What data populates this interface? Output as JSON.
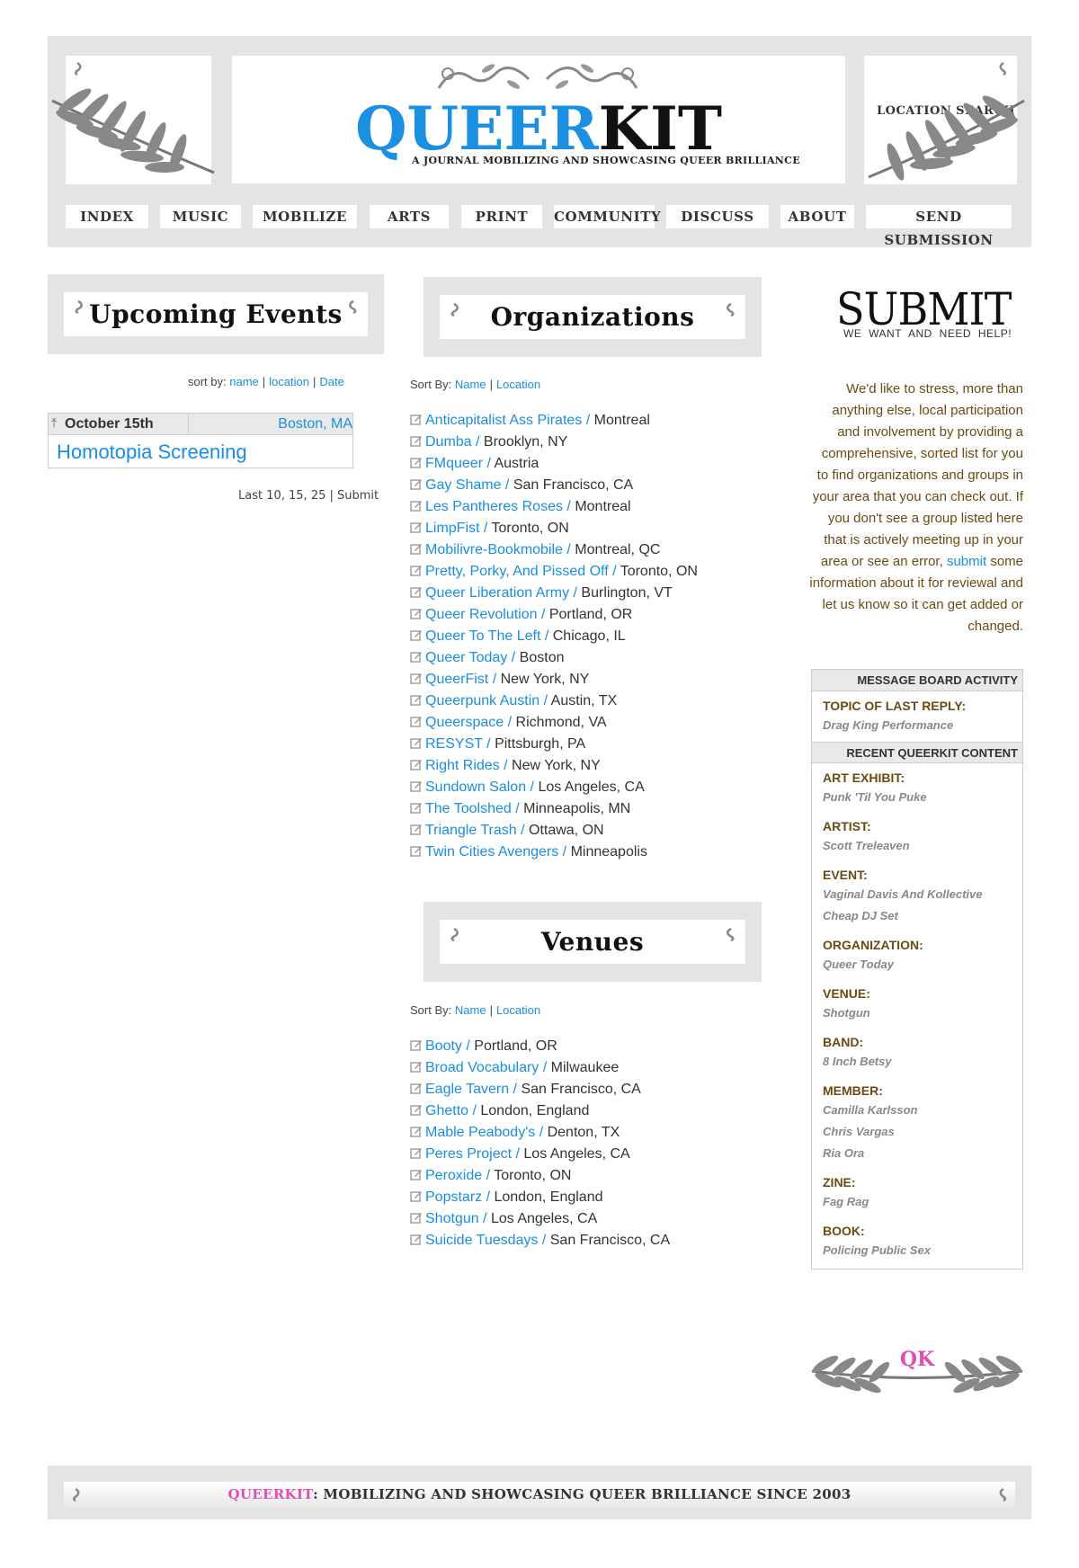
{
  "header": {
    "logo_queer": "QUEER",
    "logo_kit": "KIT",
    "tagline": "A JOURNAL MOBILIZING AND SHOWCASING QUEER BRILLIANCE",
    "location_search": "LOCATION SEARCH",
    "nav": [
      "INDEX",
      "MUSIC",
      "MOBILIZE",
      "ARTS",
      "PRINT",
      "COMMUNITY",
      "DISCUSS",
      "ABOUT",
      "SEND SUBMISSION"
    ]
  },
  "events": {
    "title": "Upcoming Events",
    "sort_prefix": "sort by:",
    "sort_links": [
      "name",
      "location",
      "Date"
    ],
    "items": [
      {
        "date": "October 15th",
        "location": "Boston, MA",
        "title": "Homotopia Screening"
      }
    ],
    "footer": "Last 10, 15, 25 | Submit"
  },
  "organizations": {
    "title": "Organizations",
    "sort_prefix": "Sort By:",
    "sort_links": [
      "Name",
      "Location"
    ],
    "items": [
      {
        "name": "Anticapitalist Ass Pirates /",
        "location": "Montreal"
      },
      {
        "name": "Dumba /",
        "location": "Brooklyn, NY"
      },
      {
        "name": "FMqueer /",
        "location": "Austria"
      },
      {
        "name": "Gay Shame /",
        "location": "San Francisco, CA"
      },
      {
        "name": "Les Pantheres Roses /",
        "location": "Montreal"
      },
      {
        "name": "LimpFist /",
        "location": "Toronto, ON"
      },
      {
        "name": "Mobilivre-Bookmobile /",
        "location": "Montreal, QC"
      },
      {
        "name": "Pretty, Porky, And Pissed Off /",
        "location": "Toronto, ON"
      },
      {
        "name": "Queer Liberation Army /",
        "location": "Burlington, VT"
      },
      {
        "name": "Queer Revolution /",
        "location": "Portland, OR"
      },
      {
        "name": "Queer To The Left /",
        "location": "Chicago, IL"
      },
      {
        "name": "Queer Today /",
        "location": "Boston"
      },
      {
        "name": "QueerFist /",
        "location": "New York, NY"
      },
      {
        "name": "Queerpunk Austin /",
        "location": "Austin, TX"
      },
      {
        "name": "Queerspace /",
        "location": "Richmond, VA"
      },
      {
        "name": "RESYST /",
        "location": "Pittsburgh, PA"
      },
      {
        "name": "Right Rides /",
        "location": "New York, NY"
      },
      {
        "name": "Sundown Salon /",
        "location": "Los Angeles, CA"
      },
      {
        "name": "The Toolshed /",
        "location": "Minneapolis, MN"
      },
      {
        "name": "Triangle Trash /",
        "location": "Ottawa, ON"
      },
      {
        "name": "Twin Cities Avengers /",
        "location": "Minneapolis"
      }
    ]
  },
  "venues": {
    "title": "Venues",
    "sort_prefix": "Sort By:",
    "sort_links": [
      "Name",
      "Location"
    ],
    "items": [
      {
        "name": "Booty /",
        "location": "Portland, OR"
      },
      {
        "name": "Broad Vocabulary /",
        "location": "Milwaukee"
      },
      {
        "name": "Eagle Tavern /",
        "location": "San Francisco, CA"
      },
      {
        "name": "Ghetto /",
        "location": "London, England"
      },
      {
        "name": "Mable Peabody's /",
        "location": "Denton, TX"
      },
      {
        "name": "Peres Project /",
        "location": "Los Angeles, CA"
      },
      {
        "name": "Peroxide /",
        "location": "Toronto, ON"
      },
      {
        "name": "Popstarz /",
        "location": "London, England"
      },
      {
        "name": "Shotgun /",
        "location": "Los Angeles, CA"
      },
      {
        "name": "Suicide Tuesdays /",
        "location": "San Francisco, CA"
      }
    ]
  },
  "submit": {
    "heading": "SUBMIT",
    "subheading": "WE WANT AND NEED HELP!",
    "para_before": "We'd like to stress, more than anything else, local participation and involvement by providing a comprehensive, sorted list for you to find organizations and groups in your area that you can check out. If you don't see a group listed here that is actively meeting up in your area or see an error,",
    "para_link": "submit",
    "para_after": "some information about it for reviewal and let us know so it can get added or changed."
  },
  "board": {
    "activity_title": "MESSAGE BOARD ACTIVITY",
    "last_reply_label": "TOPIC OF LAST REPLY:",
    "last_reply_value": "Drag King Performance",
    "recent_title": "RECENT QUEERKIT CONTENT",
    "recent": [
      {
        "label": "ART EXHIBIT:",
        "values": [
          "Punk 'Til You Puke"
        ]
      },
      {
        "label": "ARTIST:",
        "values": [
          "Scott Treleaven"
        ]
      },
      {
        "label": "EVENT:",
        "values": [
          "Vaginal Davis And Kollective",
          "Cheap DJ Set"
        ]
      },
      {
        "label": "ORGANIZATION:",
        "values": [
          "Queer Today"
        ]
      },
      {
        "label": "VENUE:",
        "values": [
          "Shotgun"
        ]
      },
      {
        "label": "BAND:",
        "values": [
          "8 Inch Betsy"
        ]
      },
      {
        "label": "MEMBER:",
        "values": [
          "Camilla Karlsson",
          "Chris Vargas",
          "Ria Ora"
        ]
      },
      {
        "label": "ZINE:",
        "values": [
          "Fag Rag"
        ]
      },
      {
        "label": "BOOK:",
        "values": [
          "Policing Public Sex"
        ]
      }
    ]
  },
  "qk_ornament": "QK",
  "footer": {
    "brand": "QUEERKIT",
    "text": ": MOBILIZING AND SHOWCASING QUEER BRILLIANCE SINCE 2003"
  },
  "colors": {
    "link": "#1a8ee0",
    "brown": "#6b4b12",
    "pink": "#e04fb4",
    "panel": "#e4e4e4"
  }
}
